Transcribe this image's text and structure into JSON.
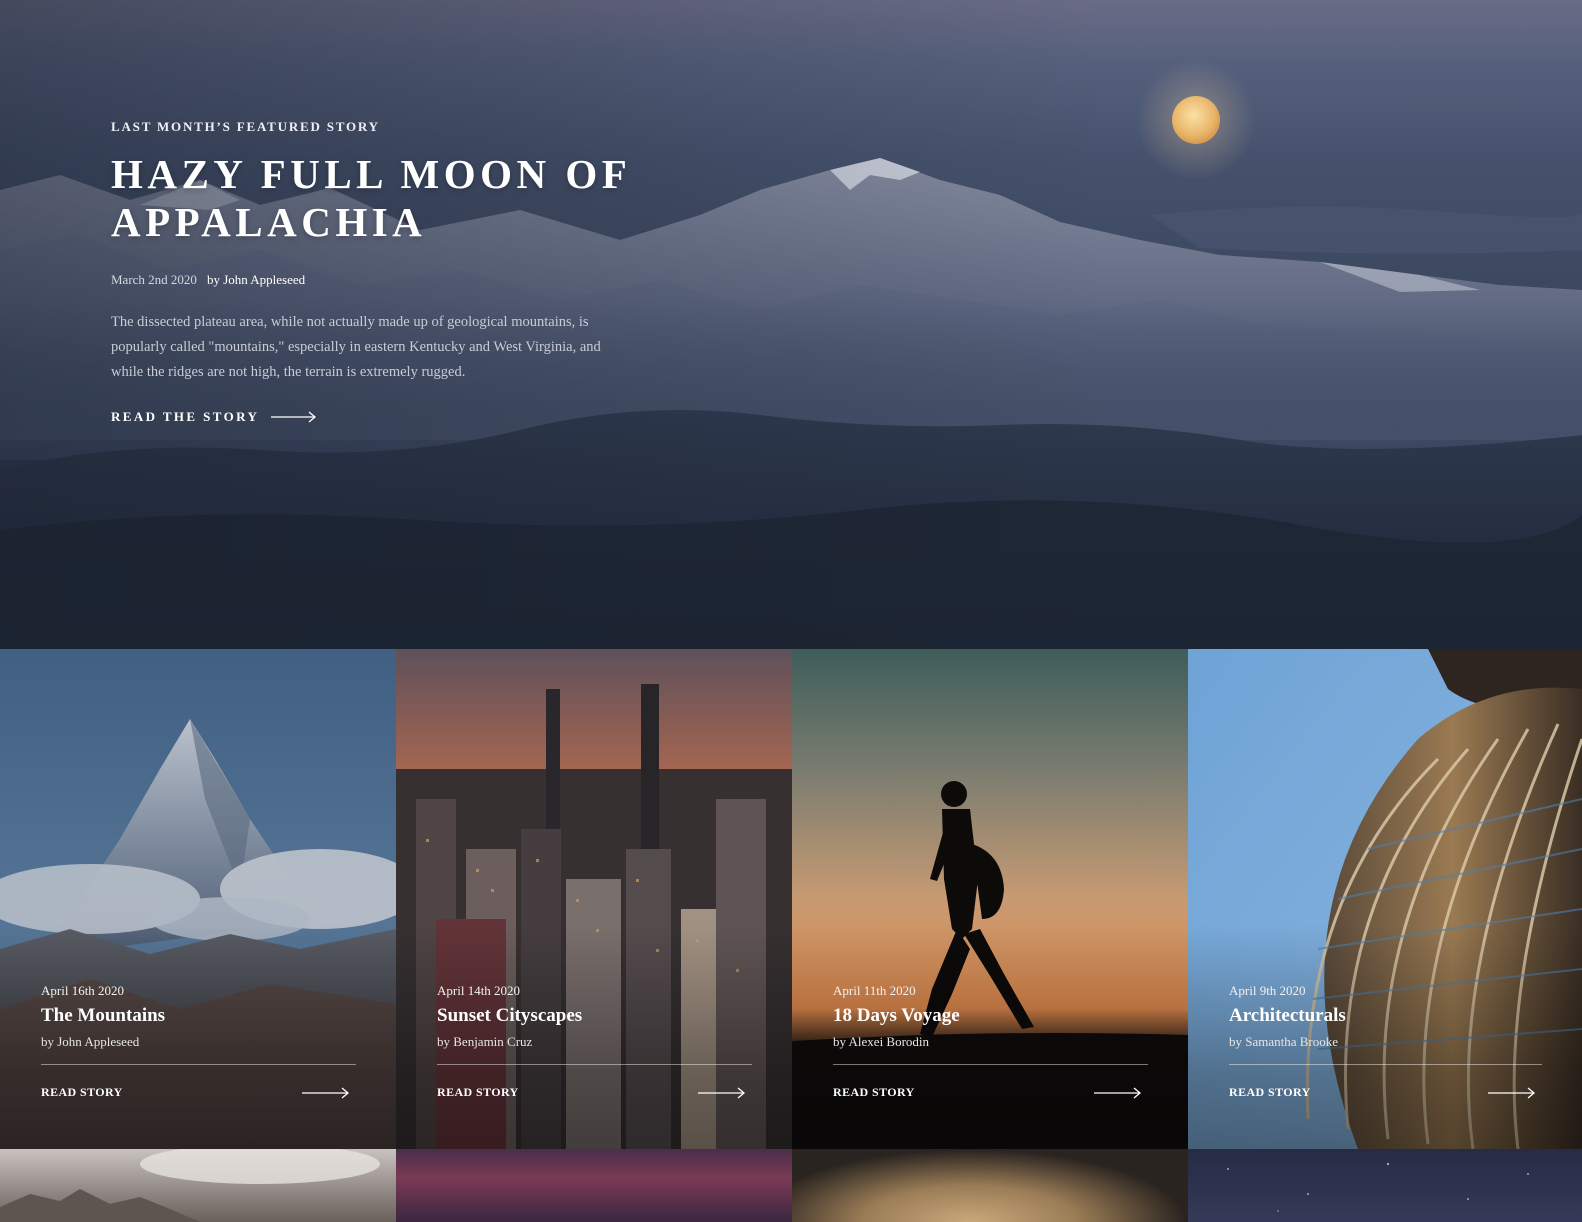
{
  "featured": {
    "eyebrow": "Last Month’s Featured Story",
    "title": "Hazy Full Moon of Appalachia",
    "date": "March 2nd 2020",
    "author": "by John Appleseed",
    "excerpt": "The dissected plateau area, while not actually made up of geological mountains, is popularly called \"mountains,\" especially in eastern Kentucky and West Virginia, and while the ridges are not high, the terrain is extremely rugged.",
    "cta": "Read the story",
    "icon": "arrow-right-icon"
  },
  "cards": [
    {
      "date": "April 16th 2020",
      "title": "The Mountains",
      "author": "by John Appleseed",
      "cta": "Read Story"
    },
    {
      "date": "April 14th 2020",
      "title": "Sunset Cityscapes",
      "author": "by Benjamin Cruz",
      "cta": "Read Story"
    },
    {
      "date": "April 11th 2020",
      "title": "18 Days Voyage",
      "author": "by Alexei Borodin",
      "cta": "Read Story"
    },
    {
      "date": "April 9th 2020",
      "title": "Architecturals",
      "author": "by Samantha Brooke",
      "cta": "Read Story"
    }
  ],
  "colors": {
    "hero_sky": "#55607c",
    "moon": "#f0c27a",
    "text_primary": "#ffffff",
    "text_muted": "#c8ccd6"
  }
}
